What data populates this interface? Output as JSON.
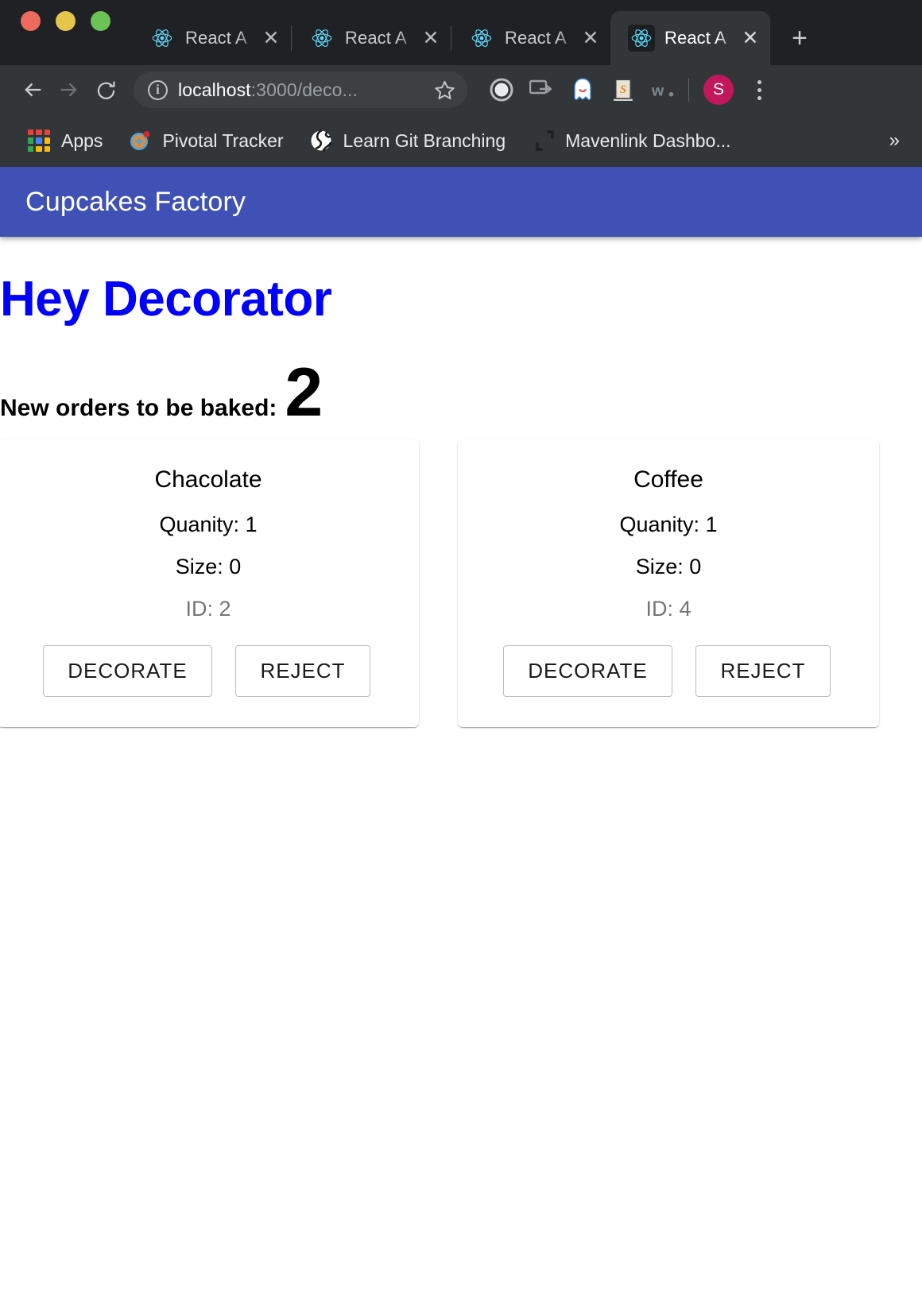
{
  "browser": {
    "window_controls": [
      {
        "name": "close",
        "color": "#ec6a5e"
      },
      {
        "name": "minimize",
        "color": "#e4c64b"
      },
      {
        "name": "maximize",
        "color": "#6cc254"
      }
    ],
    "tabs": [
      {
        "title": "React A",
        "icon": "react-icon",
        "active": false
      },
      {
        "title": "React A",
        "icon": "react-icon",
        "active": false
      },
      {
        "title": "React A",
        "icon": "react-icon",
        "active": false
      },
      {
        "title": "React A",
        "icon": "react-icon",
        "active": true
      }
    ],
    "new_tab_label": "+",
    "close_tab_label": "✕",
    "toolbar": {
      "back_icon": "back-arrow-icon",
      "forward_icon": "forward-arrow-icon",
      "reload_icon": "reload-icon",
      "site_info_icon": "info-circle-icon",
      "url_host": "localhost",
      "url_path": ":3000/deco...",
      "bookmark_icon": "star-icon",
      "extensions": [
        "grammarly-extension-icon",
        "screencast-extension-icon",
        "ghost-extension-icon",
        "sublime-extension-icon",
        "wappalyzer-extension-icon"
      ],
      "profile_initial": "S",
      "menu_icon": "kebab-menu-icon"
    },
    "bookmarks": [
      {
        "label": "Apps",
        "icon": "apps-grid-icon"
      },
      {
        "label": "Pivotal Tracker",
        "icon": "pivotal-tracker-icon"
      },
      {
        "label": "Learn Git Branching",
        "icon": "globe-icon"
      },
      {
        "label": "Mavenlink Dashbo...",
        "icon": "mavenlink-icon"
      }
    ],
    "bookmarks_overflow_label": "»"
  },
  "app": {
    "appbar": {
      "title": "Cupcakes Factory",
      "color": "#3f51b5"
    },
    "heading": {
      "text": "Hey Decorator",
      "color": "#0000ff"
    },
    "orders": {
      "label": "New orders to be baked:",
      "count": "2"
    },
    "cards": [
      {
        "title": "Chacolate",
        "quantity": "Quanity: 1",
        "size": "Size: 0",
        "id": "ID: 2",
        "decorate_label": "DECORATE",
        "reject_label": "REJECT"
      },
      {
        "title": "Coffee",
        "quantity": "Quanity: 1",
        "size": "Size: 0",
        "id": "ID: 4",
        "decorate_label": "DECORATE",
        "reject_label": "REJECT"
      }
    ]
  }
}
